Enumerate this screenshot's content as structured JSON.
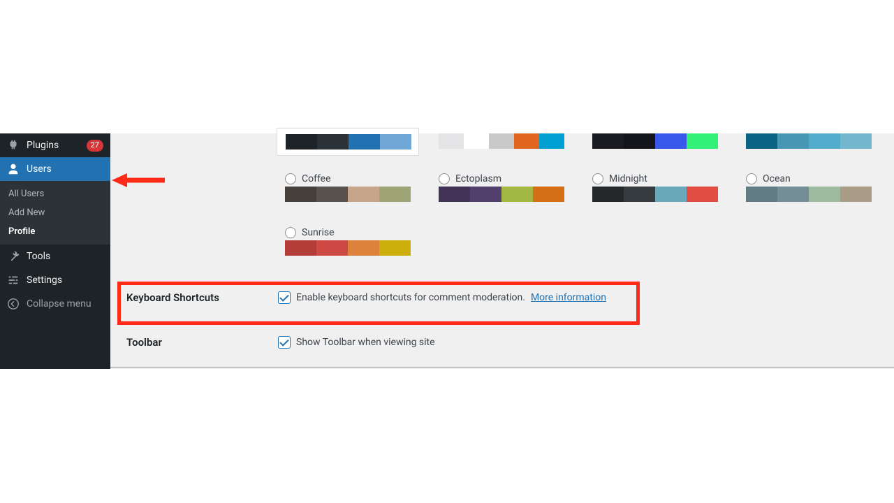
{
  "sidebar": {
    "items": [
      {
        "id": "plugins",
        "label": "Plugins",
        "badge": "27"
      },
      {
        "id": "users",
        "label": "Users"
      },
      {
        "id": "tools",
        "label": "Tools"
      },
      {
        "id": "settings",
        "label": "Settings"
      },
      {
        "id": "collapse",
        "label": "Collapse menu"
      }
    ],
    "submenu": [
      {
        "label": "All Users",
        "current": false
      },
      {
        "label": "Add New",
        "current": false
      },
      {
        "label": "Profile",
        "current": true
      }
    ]
  },
  "schemes": {
    "row1_swatch_only": [
      {
        "selected": true,
        "colors": [
          "#1d2327",
          "#2c3338",
          "#2271b1",
          "#71a7d7"
        ]
      },
      {
        "selected": false,
        "colors": [
          "#e4e4e7",
          "#ffffff",
          "#c9c9c9",
          "#e1651f",
          "#00a0d2"
        ]
      },
      {
        "selected": false,
        "colors": [
          "#1b1b22",
          "#14141b",
          "#3858e9",
          "#33f078"
        ]
      },
      {
        "selected": false,
        "colors": [
          "#096484",
          "#4796b3",
          "#52accc",
          "#74B6CE"
        ]
      }
    ],
    "row2": [
      {
        "name": "Coffee",
        "colors": [
          "#46403c",
          "#59524c",
          "#c7a589",
          "#9ea476"
        ]
      },
      {
        "name": "Ectoplasm",
        "colors": [
          "#413256",
          "#523f6d",
          "#a3b745",
          "#d46f15"
        ]
      },
      {
        "name": "Midnight",
        "colors": [
          "#25282b",
          "#363b3f",
          "#69a8bb",
          "#e14d43"
        ]
      },
      {
        "name": "Ocean",
        "colors": [
          "#627c83",
          "#738e96",
          "#9ebaa0",
          "#aa9d88"
        ]
      }
    ],
    "row3": [
      {
        "name": "Sunrise",
        "colors": [
          "#b43c38",
          "#cf4944",
          "#dd823b",
          "#ccaf0b"
        ]
      }
    ]
  },
  "keyboard": {
    "label": "Keyboard Shortcuts",
    "checkbox_label": "Enable keyboard shortcuts for comment moderation.",
    "link_text": "More information",
    "checked": true
  },
  "toolbar": {
    "label": "Toolbar",
    "checkbox_label": "Show Toolbar when viewing site",
    "checked": true
  }
}
